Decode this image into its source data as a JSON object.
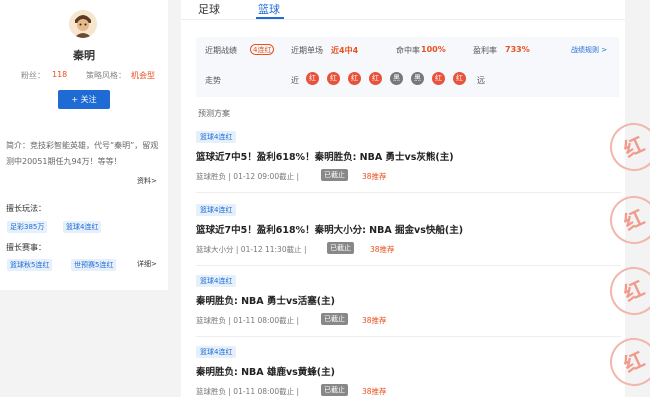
{
  "profile": {
    "name": "秦明",
    "fans_label": "粉丝：",
    "fans_value": "118",
    "style_label": "策略风格：",
    "style_value": "机会型",
    "follow_label": "+ 关注",
    "intro_label": "简介：",
    "intro_text": "竞技彩智能英雄，代号“秦明”，留观测中20051期任九94万！等等！",
    "more_label": "资料>",
    "good_play_title": "擅长玩法：",
    "good_play_tags": [
      "足彩385万",
      "篮球4连红"
    ],
    "good_event_title": "擅长赛事：",
    "good_event_tags": [
      "篮球秋5连红",
      "世预赛5连红"
    ],
    "detail_label": "详细>"
  },
  "tabs": [
    "足球",
    "篮球"
  ],
  "active_tab": "篮球",
  "summary": {
    "recent_label": "近期战绩",
    "streak_badge": "4连红",
    "single_label": "近期单场",
    "single_value": "近4中4",
    "hit_label": "命中率",
    "hit_value": "100%",
    "profit_label": "盈利率",
    "profit_value": "733%",
    "rules_label": "战绩规则 >",
    "trend_label": "走势",
    "near_label": "近",
    "far_label": "远",
    "trend": [
      {
        "text": "红",
        "color": "#e8523a"
      },
      {
        "text": "红",
        "color": "#e8523a"
      },
      {
        "text": "红",
        "color": "#e8523a"
      },
      {
        "text": "红",
        "color": "#e8523a"
      },
      {
        "text": "黑",
        "color": "#777777"
      },
      {
        "text": "黑",
        "color": "#777777"
      },
      {
        "text": "红",
        "color": "#e8523a"
      },
      {
        "text": "红",
        "color": "#e8523a"
      }
    ]
  },
  "plan_title": "预测方案",
  "plans": [
    {
      "tag": "篮球4连红",
      "title": "篮球近7中5！盈利618%！秦明胜负: NBA 勇士vs灰熊(主)",
      "play": "篮球胜负",
      "time": "01-12 09:00截止",
      "status": "已截止",
      "price": "38推荐",
      "stamp": "红"
    },
    {
      "tag": "篮球4连红",
      "title": "篮球近7中5！盈利618%！秦明大小分: NBA 掘金vs快船(主)",
      "play": "篮球大小分",
      "time": "01-12 11:30截止",
      "status": "已截止",
      "price": "38推荐",
      "stamp": "红"
    },
    {
      "tag": "篮球4连红",
      "title": "秦明胜负: NBA 勇士vs活塞(主)",
      "play": "篮球胜负",
      "time": "01-11 08:00截止",
      "status": "已截止",
      "price": "38推荐",
      "stamp": "红"
    },
    {
      "tag": "篮球4连红",
      "title": "秦明胜负: NBA 雄鹿vs黄蜂(主)",
      "play": "篮球胜负",
      "time": "01-11 08:00截止",
      "status": "已截止",
      "price": "38推荐",
      "stamp": "红"
    }
  ]
}
